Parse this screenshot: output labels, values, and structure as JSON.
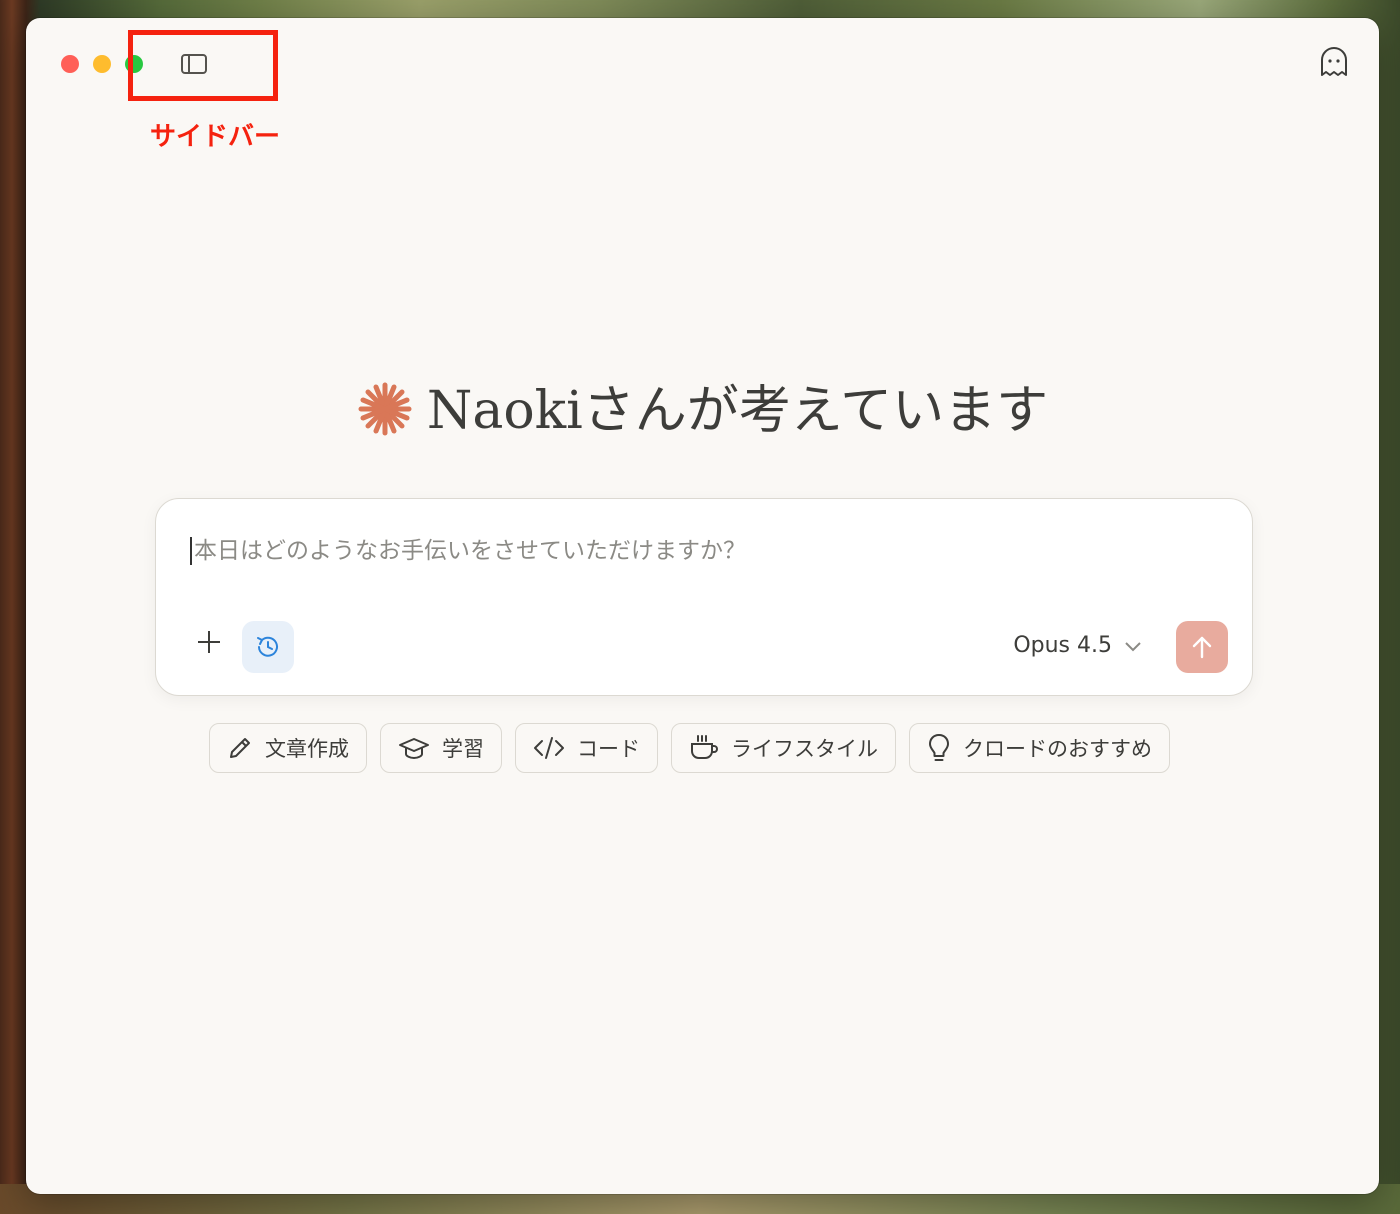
{
  "window": {
    "annotation_label": "サイドバー"
  },
  "main": {
    "greeting": "Naokiさんが考えています",
    "accent_color": "#d97757"
  },
  "composer": {
    "placeholder": "本日はどのようなお手伝いをさせていただけますか？",
    "model": "Opus 4.5"
  },
  "chips": [
    {
      "label": "文章作成",
      "icon": "pencil-icon"
    },
    {
      "label": "学習",
      "icon": "graduation-cap-icon"
    },
    {
      "label": "コード",
      "icon": "code-icon"
    },
    {
      "label": "ライフスタイル",
      "icon": "coffee-cup-icon"
    },
    {
      "label": "クロードのおすすめ",
      "icon": "lightbulb-icon"
    }
  ]
}
